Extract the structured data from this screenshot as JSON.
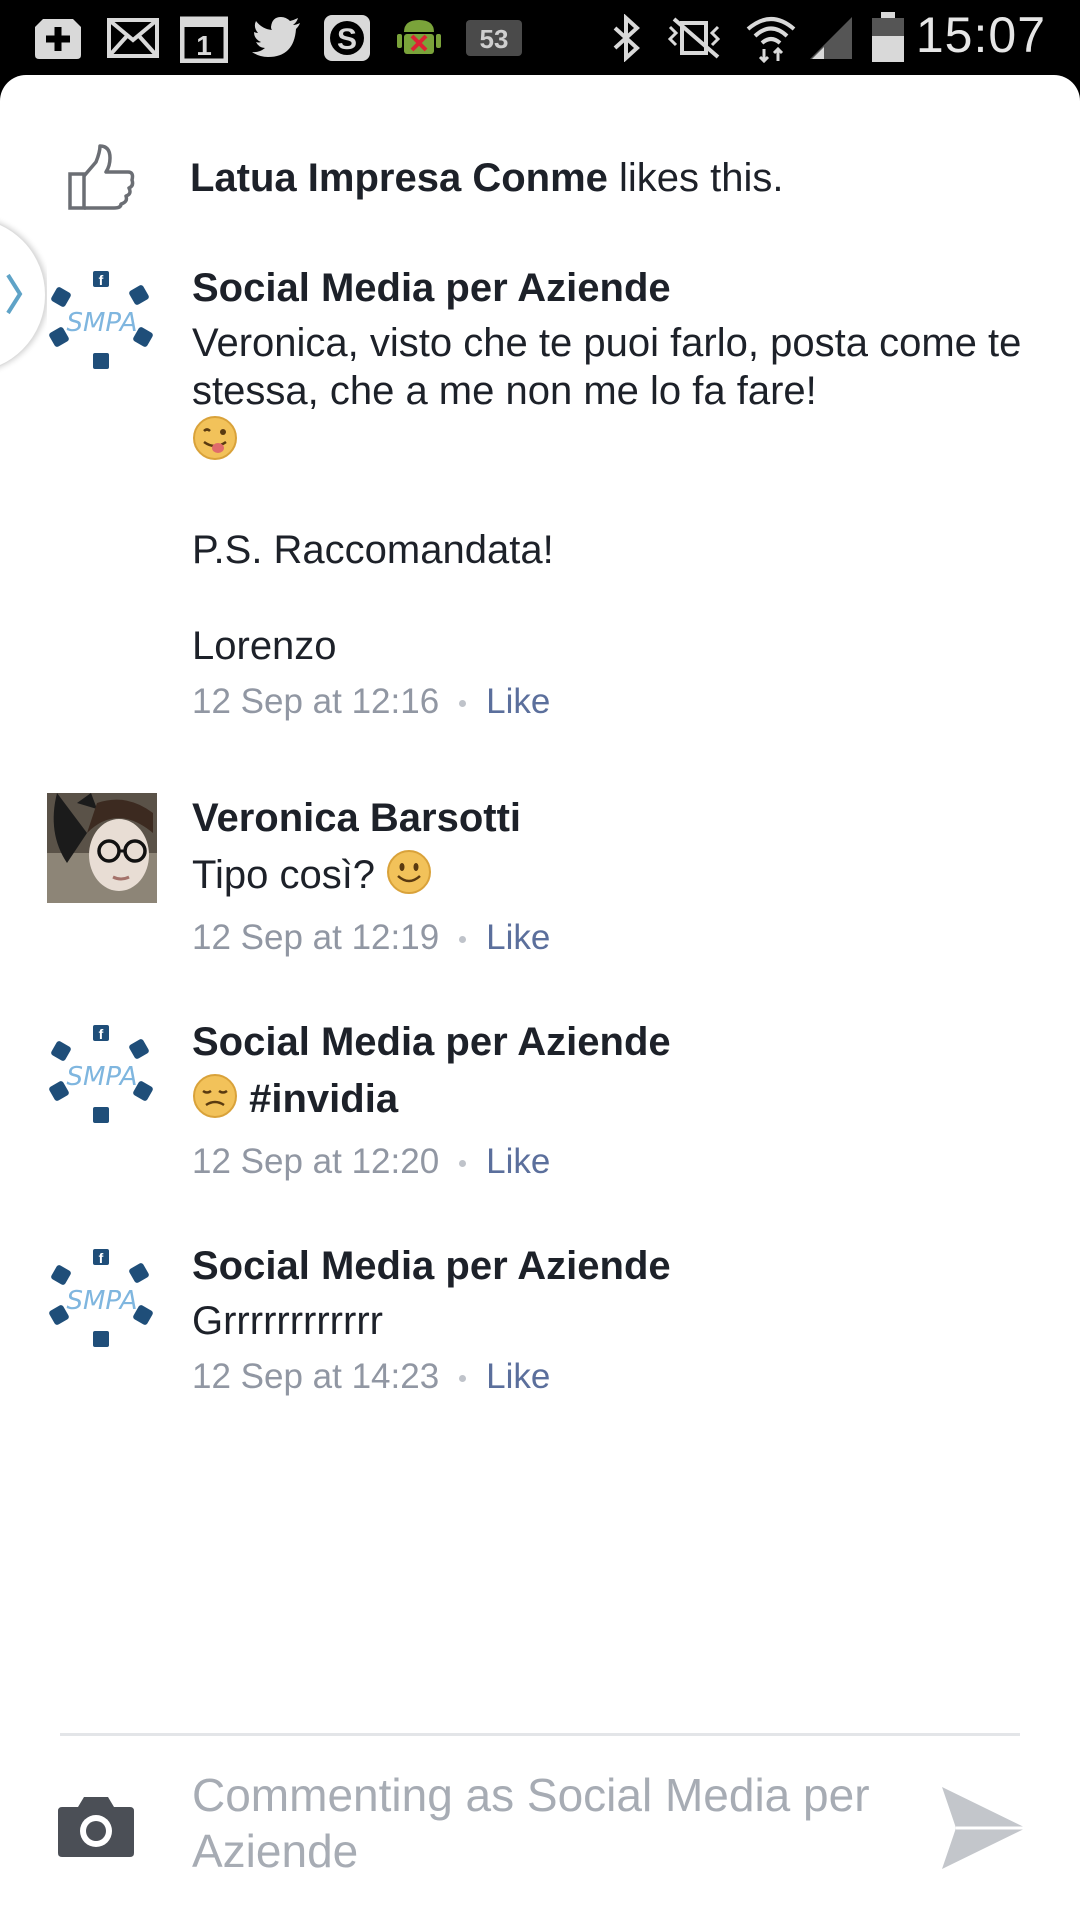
{
  "status_bar": {
    "time": "15:07",
    "notification_badge": "53",
    "icons": [
      "add-icon",
      "mail-icon",
      "calendar-icon",
      "twitter-icon",
      "skype-icon",
      "android-debug-icon",
      "badge-icon",
      "bluetooth-icon",
      "vibrate-icon",
      "wifi-icon",
      "signal-icon",
      "battery-icon"
    ],
    "calendar_day": "1"
  },
  "likes": {
    "name": "Latua Impresa Conme",
    "suffix": " likes this."
  },
  "comments": [
    {
      "author": "Social Media per Aziende",
      "text_line1": "Veronica, visto che te puoi farlo, posta come te stessa, che a me non me lo fa fare!",
      "emoji": "winking-tongue-emoji",
      "text_ps": "P.S. Raccomandata!",
      "text_sign": "Lorenzo",
      "time": "12 Sep at 12:16",
      "like_label": "Like"
    },
    {
      "author": "Veronica Barsotti",
      "text": "Tipo così?",
      "emoji": "smile-emoji",
      "time": "12 Sep at 12:19",
      "like_label": "Like"
    },
    {
      "author": "Social Media per Aziende",
      "emoji": "disappointed-emoji",
      "hashtag": "#invidia",
      "time": "12 Sep at 12:20",
      "like_label": "Like"
    },
    {
      "author": "Social Media per Aziende",
      "text": "Grrrrrrrrrrrr",
      "time": "12 Sep at 14:23",
      "like_label": "Like"
    }
  ],
  "avatar_logo_text": "SMPA",
  "composer": {
    "placeholder": "Commenting as Social Media per Aziende"
  },
  "colors": {
    "link": "#5b6f9c",
    "meta": "#9197a3",
    "text": "#1d2129",
    "logo": "#1f4e79",
    "logo_accent": "#7fb6df"
  }
}
